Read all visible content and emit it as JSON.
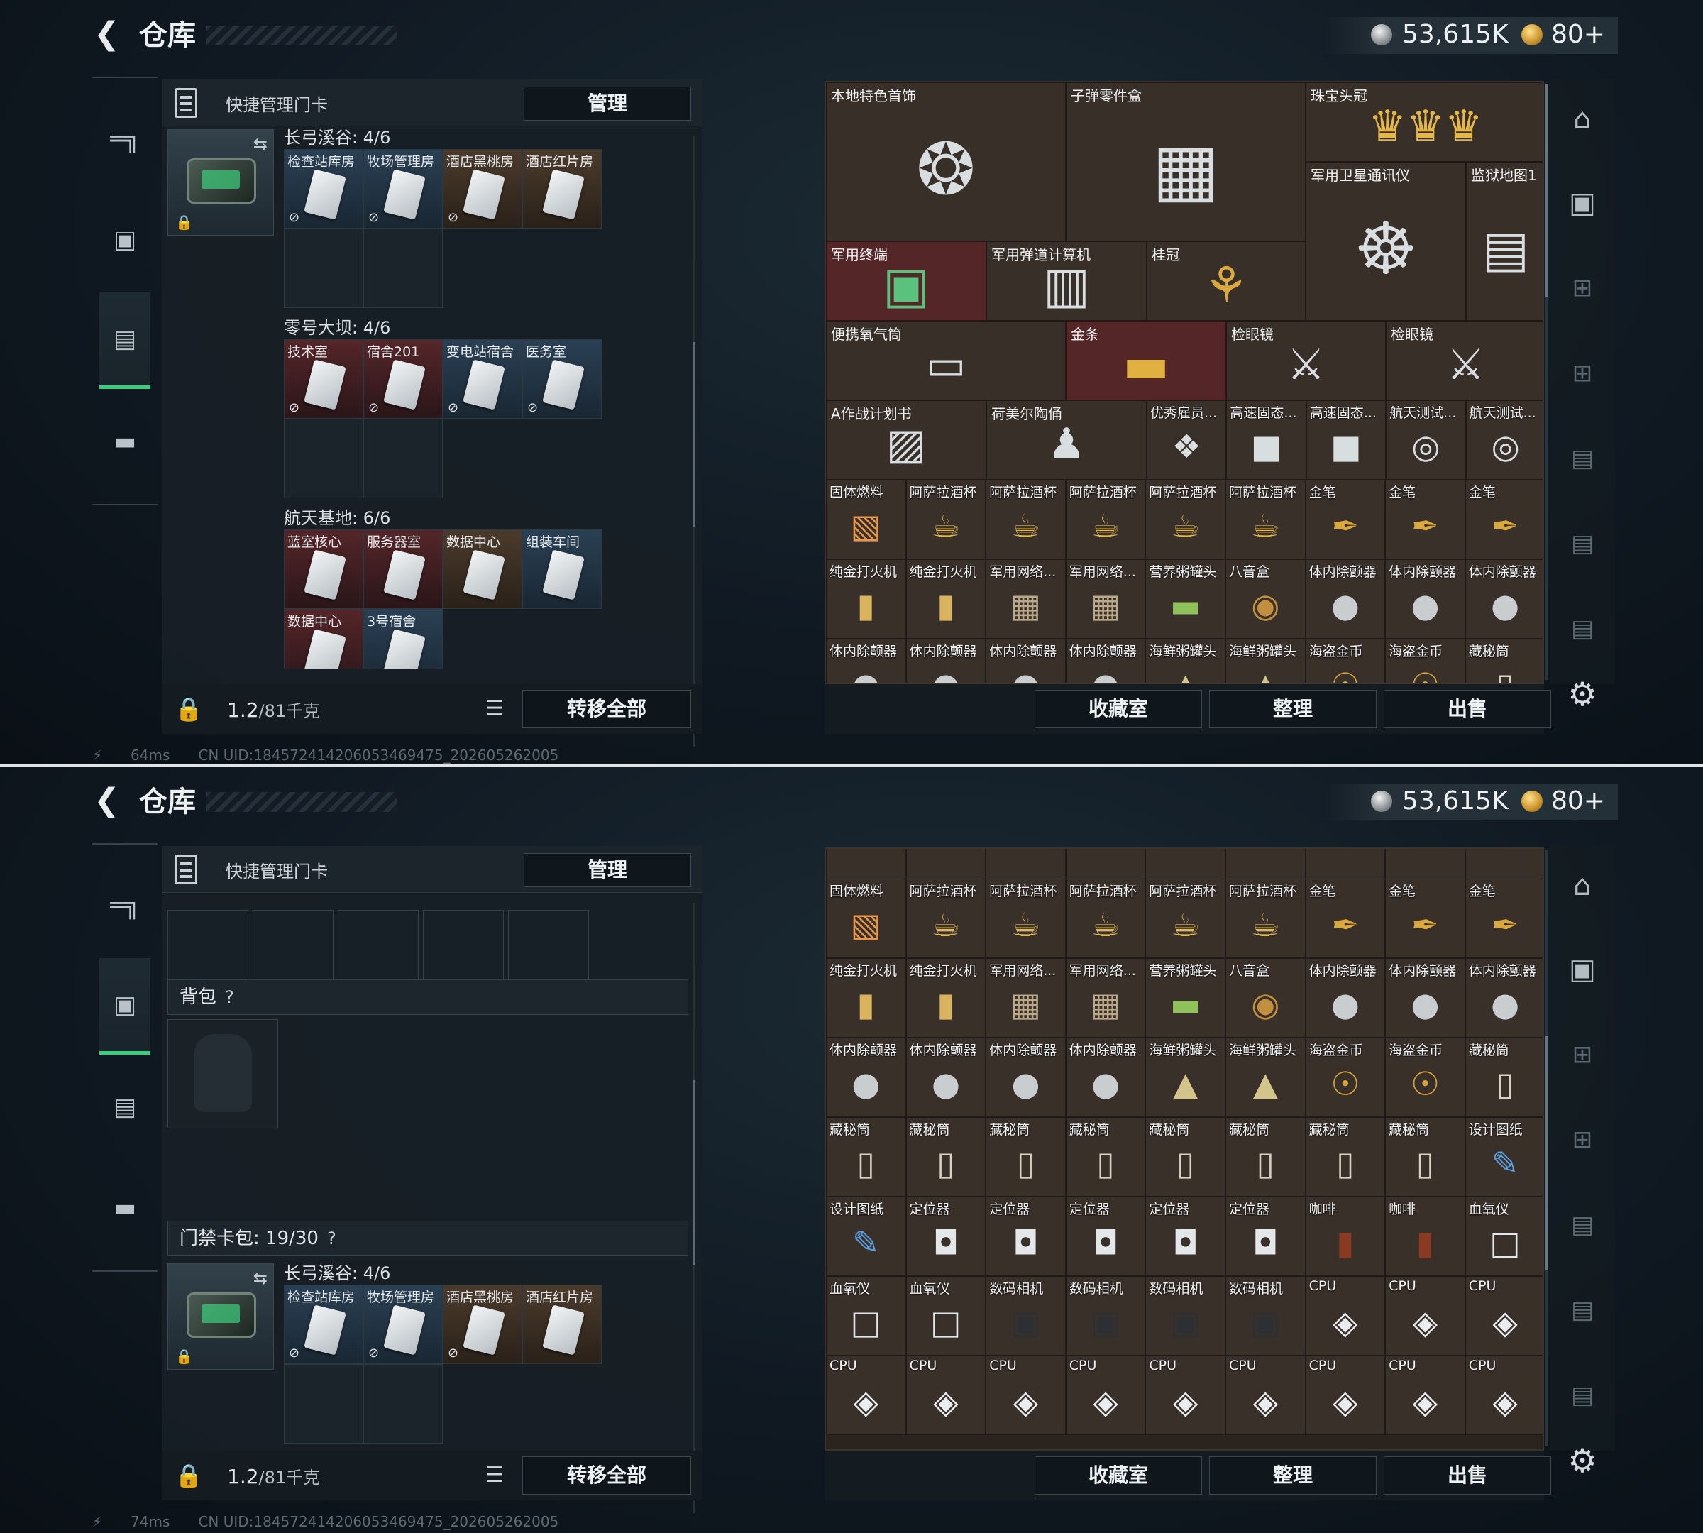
{
  "app": {
    "title": "仓库",
    "balance_silver": "53,615K",
    "balance_gold": "80+"
  },
  "icons": {
    "back": "back-arrow-icon",
    "silver": "silver-coin-icon",
    "gold": "gold-coin-icon",
    "weapon": "gun-icon",
    "backpack": "backpack-icon",
    "keycard": "keycard-icon",
    "case": "briefcase-icon",
    "gear": "gear-icon",
    "list": "list-icon",
    "lock": "lock-icon",
    "swap": "swap-icon"
  },
  "left": {
    "quick_title": "快捷管理门卡",
    "manage_label": "管理",
    "weight": "1.2",
    "weight_cap": "/81千克",
    "transfer_label": "转移全部",
    "backpack_label": "背包",
    "help": "?",
    "keycard_bag": "门禁卡包: 19/30"
  },
  "groups": [
    {
      "label": "长弓溪谷: 4/6",
      "cards": [
        {
          "name": "检查站库房",
          "tone": "blue"
        },
        {
          "name": "牧场管理房",
          "tone": "blue"
        },
        {
          "name": "酒店黑桃房",
          "tone": "brown"
        },
        {
          "name": "酒店红片房",
          "tone": "brown"
        }
      ]
    },
    {
      "label": "零号大坝: 4/6",
      "cards": [
        {
          "name": "技术室",
          "tone": "red"
        },
        {
          "name": "宿舍201",
          "tone": "red"
        },
        {
          "name": "变电站宿舍",
          "tone": "blue"
        },
        {
          "name": "医务室",
          "tone": "blue"
        }
      ]
    },
    {
      "label": "航天基地: 6/6",
      "cards": [
        {
          "name": "蓝室核心",
          "tone": "red"
        },
        {
          "name": "服务器室",
          "tone": "red"
        },
        {
          "name": "数据中心",
          "tone": "brown"
        },
        {
          "name": "组装车间",
          "tone": "blue"
        },
        {
          "name": "数据中心",
          "tone": "red"
        },
        {
          "name": "3号宿舍",
          "tone": "blue"
        }
      ]
    }
  ],
  "status": {
    "ping1": "64ms",
    "ping2": "74ms",
    "uid": "CN UID:1845724142060534694​75_202605262005"
  },
  "stash_top": {
    "big": [
      {
        "name": "本地特色首饰"
      },
      {
        "name": "子弹零件盒"
      },
      {
        "name": "珠宝头冠"
      },
      {
        "name": "军用卫星通讯仪"
      },
      {
        "name": "监狱地图1"
      },
      {
        "name": "军用终端"
      },
      {
        "name": "军用弹道计算机"
      },
      {
        "name": "桂冠"
      },
      {
        "name": "便携氧气筒"
      },
      {
        "name": "金条"
      },
      {
        "name": "检眼镜"
      },
      {
        "name": "检眼镜"
      }
    ],
    "row1": [
      "A作战计划书",
      "荷美尔陶俑",
      "优秀雇员...",
      "高速固态...",
      "高速固态...",
      "航天测试...",
      "航天测试..."
    ],
    "row2": [
      "固体燃料",
      "阿萨拉酒杯",
      "阿萨拉酒杯",
      "阿萨拉酒杯",
      "阿萨拉酒杯",
      "阿萨拉酒杯",
      "金笔",
      "金笔",
      "金笔"
    ],
    "row3": [
      "纯金打火机",
      "纯金打火机",
      "军用网络...",
      "军用网络...",
      "营养粥罐头",
      "八音盒",
      "体内除颤器",
      "体内除颤器",
      "体内除颤器"
    ],
    "row4": [
      "体内除颤器",
      "体内除颤器",
      "体内除颤器",
      "体内除颤器",
      "海鲜粥罐头",
      "海鲜粥罐头",
      "海盗金币",
      "海盗金币",
      "藏秘筒"
    ]
  },
  "stash_bottom": {
    "row1": [
      "固体燃料",
      "阿萨拉酒杯",
      "阿萨拉酒杯",
      "阿萨拉酒杯",
      "阿萨拉酒杯",
      "阿萨拉酒杯",
      "金笔",
      "金笔",
      "金笔"
    ],
    "row2": [
      "纯金打火机",
      "纯金打火机",
      "军用网络...",
      "军用网络...",
      "营养粥罐头",
      "八音盒",
      "体内除颤器",
      "体内除颤器",
      "体内除颤器"
    ],
    "row3": [
      "体内除颤器",
      "体内除颤器",
      "体内除颤器",
      "体内除颤器",
      "海鲜粥罐头",
      "海鲜粥罐头",
      "海盗金币",
      "海盗金币",
      "藏秘筒"
    ],
    "row4": [
      "藏秘筒",
      "藏秘筒",
      "藏秘筒",
      "藏秘筒",
      "藏秘筒",
      "藏秘筒",
      "藏秘筒",
      "藏秘筒",
      "设计图纸"
    ],
    "row5": [
      "设计图纸",
      "定位器",
      "定位器",
      "定位器",
      "定位器",
      "定位器",
      "咖啡",
      "咖啡",
      "血氧仪"
    ],
    "row6": [
      "血氧仪",
      "血氧仪",
      "数码相机",
      "数码相机",
      "数码相机",
      "数码相机",
      "CPU",
      "CPU",
      "CPU"
    ],
    "row7": [
      "CPU",
      "CPU",
      "CPU",
      "CPU",
      "CPU",
      "CPU",
      "CPU",
      "CPU",
      "CPU"
    ]
  },
  "buttons": {
    "collection": "收藏室",
    "sort": "整理",
    "sell": "出售"
  }
}
